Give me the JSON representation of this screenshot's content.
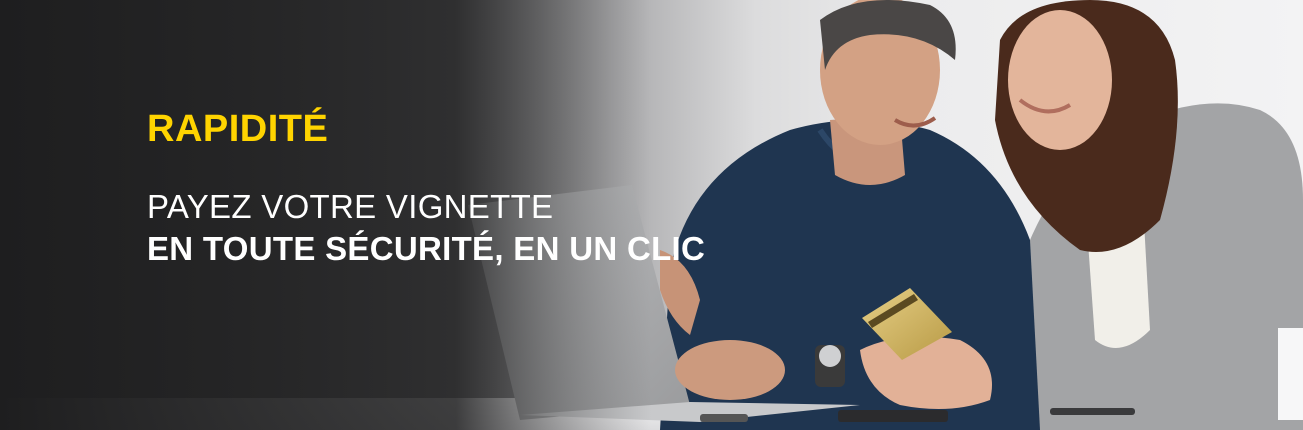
{
  "banner": {
    "headline": "RAPIDITÉ",
    "subtitle_line1": "PAYEZ VOTRE VIGNETTE",
    "subtitle_line2": "EN TOUTE SÉCURITÉ, EN UN CLIC"
  },
  "colors": {
    "accent": "#ffd400",
    "text": "#ffffff",
    "dark_overlay": "#1e1e1f"
  },
  "icons": {
    "photo": "couple-paying-online-photo"
  }
}
